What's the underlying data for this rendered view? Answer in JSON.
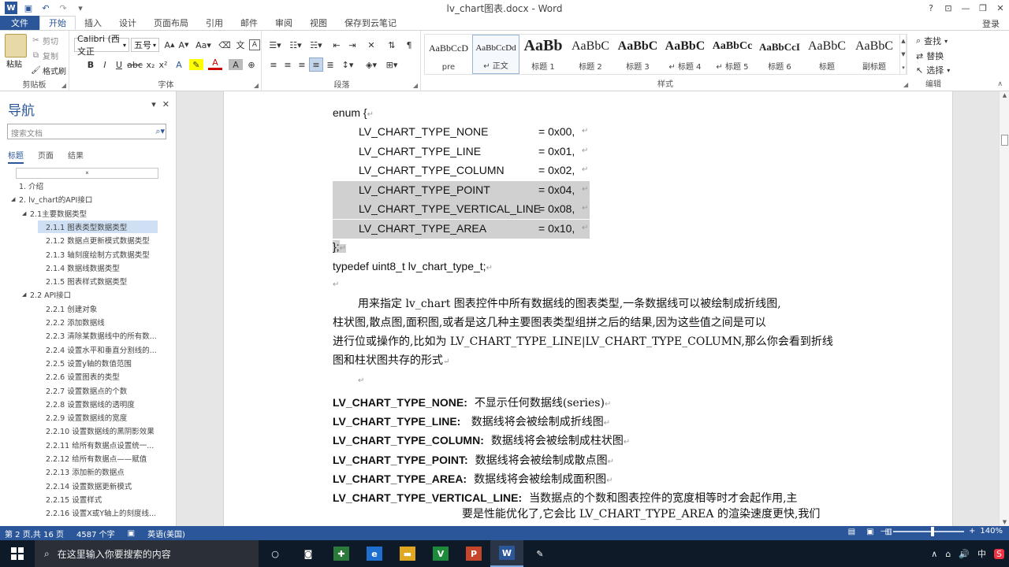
{
  "titlebar": {
    "title": "lv_chart图表.docx - Word",
    "help": "?",
    "ribbon_display": "⊡",
    "minimize": "—",
    "restore": "❐",
    "close": "✕"
  },
  "tabs": [
    "文件",
    "开始",
    "插入",
    "设计",
    "页面布局",
    "引用",
    "邮件",
    "审阅",
    "视图",
    "保存到云笔记"
  ],
  "login_label": "登录",
  "ribbon": {
    "clipboard": {
      "paste": "粘贴",
      "cut": "剪切",
      "copy": "复制",
      "format_painter": "格式刷",
      "label": "剪贴板"
    },
    "font": {
      "font_name": "Calibri (西文正",
      "font_size": "五号",
      "label": "字体"
    },
    "paragraph": {
      "label": "段落"
    },
    "styles": {
      "label": "样式",
      "items": [
        {
          "sample": "AaBbCcD",
          "name": "pre"
        },
        {
          "sample": "AaBbCcDd",
          "name": "↵ 正文"
        },
        {
          "sample": "AaBb",
          "name": "标题 1"
        },
        {
          "sample": "AaBbC",
          "name": "标题 2"
        },
        {
          "sample": "AaBbC",
          "name": "标题 3"
        },
        {
          "sample": "AaBbC",
          "name": "↵ 标题 4"
        },
        {
          "sample": "AaBbCc",
          "name": "↵ 标题 5"
        },
        {
          "sample": "AaBbCcI",
          "name": "标题 6"
        },
        {
          "sample": "AaBbC",
          "name": "标题"
        },
        {
          "sample": "AaBbC",
          "name": "副标题"
        }
      ]
    },
    "editing": {
      "find": "查找",
      "replace": "替换",
      "select": "选择",
      "label": "编辑"
    }
  },
  "nav": {
    "title": "导航",
    "search_placeholder": "搜索文档",
    "tabs": [
      "标题",
      "页面",
      "结果"
    ],
    "items": [
      {
        "label": "1. 介绍",
        "level": 1,
        "tri": ""
      },
      {
        "label": "2. lv_chart的API接口",
        "level": 1,
        "tri": "◢"
      },
      {
        "label": "2.1主要数据类型",
        "level": 2,
        "tri": "◢"
      },
      {
        "label": "2.1.1 图表类型数据类型",
        "level": 3,
        "tri": "",
        "selected": true
      },
      {
        "label": "2.1.2 数据点更新模式数据类型",
        "level": 3,
        "tri": ""
      },
      {
        "label": "2.1.3 轴刻度绘制方式数据类型",
        "level": 3,
        "tri": ""
      },
      {
        "label": "2.1.4 数据线数据类型",
        "level": 3,
        "tri": ""
      },
      {
        "label": "2.1.5 图表样式数据类型",
        "level": 3,
        "tri": ""
      },
      {
        "label": "2.2 API接口",
        "level": 2,
        "tri": "◢"
      },
      {
        "label": "2.2.1 创建对象",
        "level": 3,
        "tri": ""
      },
      {
        "label": "2.2.2 添加数据线",
        "level": 3,
        "tri": ""
      },
      {
        "label": "2.2.3 清除某数据线中的所有数...",
        "level": 3,
        "tri": ""
      },
      {
        "label": "2.2.4 设置水平和垂直分割线的...",
        "level": 3,
        "tri": ""
      },
      {
        "label": "2.2.5 设置y轴的数值范围",
        "level": 3,
        "tri": ""
      },
      {
        "label": "2.2.6 设置图表的类型",
        "level": 3,
        "tri": ""
      },
      {
        "label": "2.2.7 设置数据点的个数",
        "level": 3,
        "tri": ""
      },
      {
        "label": "2.2.8 设置数据线的透明度",
        "level": 3,
        "tri": ""
      },
      {
        "label": "2.2.9 设置数据线的宽度",
        "level": 3,
        "tri": ""
      },
      {
        "label": "2.2.10 设置数据线的黑阴影效果",
        "level": 3,
        "tri": ""
      },
      {
        "label": "2.2.11 给所有数据点设置统一...",
        "level": 3,
        "tri": ""
      },
      {
        "label": "2.2.12 给所有数据点——赋值",
        "level": 3,
        "tri": ""
      },
      {
        "label": "2.2.13 添加新的数据点",
        "level": 3,
        "tri": ""
      },
      {
        "label": "2.2.14 设置数据更新模式",
        "level": 3,
        "tri": ""
      },
      {
        "label": "2.2.15 设置样式",
        "level": 3,
        "tri": ""
      },
      {
        "label": "2.2.16 设置X或Y轴上的刻度线...",
        "level": 3,
        "tri": ""
      }
    ]
  },
  "doc": {
    "enum_open": "enum {",
    "enum_entries": [
      {
        "name": "LV_CHART_TYPE_NONE",
        "value": "= 0x00,",
        "hl": false
      },
      {
        "name": "LV_CHART_TYPE_LINE",
        "value": "= 0x01,",
        "hl": false
      },
      {
        "name": "LV_CHART_TYPE_COLUMN",
        "value": "= 0x02,",
        "hl": false
      },
      {
        "name": "LV_CHART_TYPE_POINT",
        "value": "= 0x04,",
        "hl": true
      },
      {
        "name": "LV_CHART_TYPE_VERTICAL_LINE",
        "value": "= 0x08,",
        "hl": true
      },
      {
        "name": "LV_CHART_TYPE_AREA",
        "value": "= 0x10,",
        "hl": true
      }
    ],
    "enum_close": "};",
    "typedef": "typedef uint8_t lv_chart_type_t;",
    "para_lines": [
      "用来指定  lv_chart  图表控件中所有数据线的图表类型,一条数据线可以被绘制成折线图,",
      "柱状图,散点图,面积图,或者是这几种主要图表类型组拼之后的结果,因为这些值之间是可以",
      "进行位或操作的,比如为  LV_CHART_TYPE_LINE|LV_CHART_TYPE_COLUMN,那么你会看到折线",
      "图和柱状图共存的形式"
    ],
    "defs": [
      {
        "term": "LV_CHART_TYPE_NONE:",
        "desc": "不显示任何数据线(series)"
      },
      {
        "term": "LV_CHART_TYPE_LINE:",
        "desc": "  数据线将会被绘制成折线图"
      },
      {
        "term": "LV_CHART_TYPE_COLUMN:",
        "desc": "数据线将会被绘制成柱状图"
      },
      {
        "term": "LV_CHART_TYPE_POINT:",
        "desc": "数据线将会被绘制成散点图"
      },
      {
        "term": "LV_CHART_TYPE_AREA:",
        "desc": "数据线将会被绘制成面积图"
      },
      {
        "term": "LV_CHART_TYPE_VERTICAL_LINE:",
        "desc": "当数据点的个数和图表控件的宽度相等时才会起作用,主"
      }
    ],
    "last_line": "要是性能优化了,它会比  LV_CHART_TYPE_AREA  的渲染速度更快,我们"
  },
  "status": {
    "page": "第 2 页,共 16 页",
    "words": "4587 个字",
    "lang": "英语(美国)",
    "zoom": "140%",
    "zoom_minus": "—",
    "zoom_plus": "+"
  },
  "taskbar": {
    "search_placeholder": "在这里输入你要搜索的内容",
    "apps": [
      {
        "name": "cortana",
        "glyph": "○",
        "color": "transparent"
      },
      {
        "name": "camera",
        "glyph": "◙",
        "color": "transparent"
      },
      {
        "name": "xmind",
        "glyph": "✚",
        "color": "#2a7a3a"
      },
      {
        "name": "edge",
        "glyph": "e",
        "color": "#1f6fd1"
      },
      {
        "name": "explorer",
        "glyph": "▬",
        "color": "#e0a820"
      },
      {
        "name": "vim",
        "glyph": "V",
        "color": "#1e8a3c"
      },
      {
        "name": "powerpoint",
        "glyph": "P",
        "color": "#c6462b"
      },
      {
        "name": "word",
        "glyph": "W",
        "color": "#2b579a"
      },
      {
        "name": "tool",
        "glyph": "✎",
        "color": "transparent"
      }
    ],
    "tray": {
      "ime": "中",
      "chevron": "∧"
    }
  },
  "colors": {
    "word_blue": "#2b579a",
    "highlight": "#d0d0d0",
    "nav_selected": "#cfe0f4"
  }
}
